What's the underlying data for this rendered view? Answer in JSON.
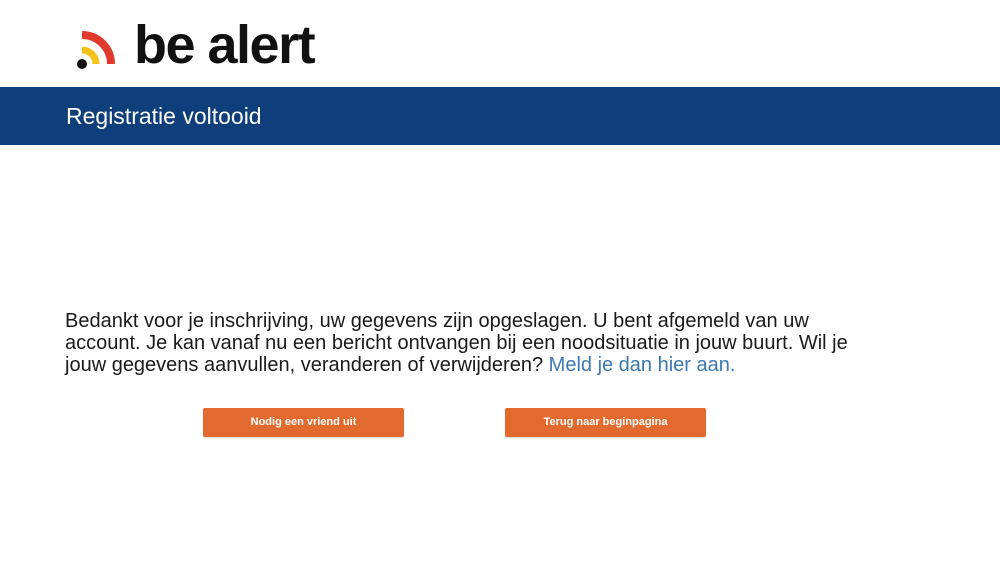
{
  "brand": {
    "logo_text": "be alert",
    "colors": {
      "dot": "#111111",
      "arc_inner": "#f5c21b",
      "arc_outer": "#e03a2f"
    }
  },
  "header": {
    "title": "Registratie voltooid",
    "background": "#0e3f7a"
  },
  "main": {
    "message": "Bedankt voor je inschrijving, uw gegevens zijn opgeslagen. U bent afgemeld van uw account. Je kan vanaf nu een bericht ontvangen bij een noodsituatie in jouw buurt. Wil je jouw gegevens aanvullen, veranderen of verwijderen? ",
    "link_text": "Meld je dan hier aan."
  },
  "buttons": {
    "invite_label": "Nodig een vriend uit",
    "home_label": "Terug naar beginpagina",
    "color": "#e36a2e"
  }
}
